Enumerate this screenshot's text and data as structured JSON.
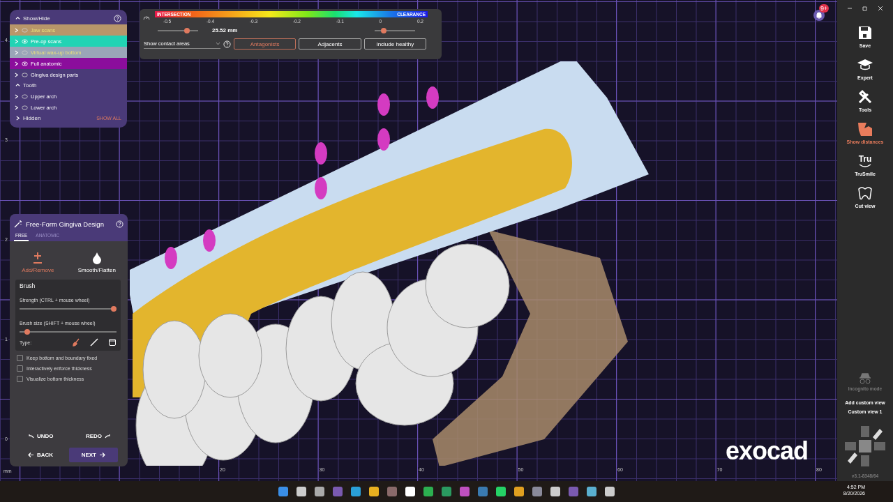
{
  "visibility_panel": {
    "sections": [
      {
        "title": "Show/Hide",
        "expanded": true,
        "items": [
          {
            "label": "Jaw scans",
            "color": "#b8966a",
            "visible": false
          },
          {
            "label": "Pre-op scans",
            "color": "#22d3b4",
            "visible": true
          },
          {
            "label": "Virtual wax-up bottom",
            "color": "#9aa5b8",
            "visible": false
          },
          {
            "label": "Full anatomic",
            "color": "#8b0d9c",
            "visible": true
          },
          {
            "label": "Gingiva design parts",
            "visible": false
          }
        ]
      },
      {
        "title": "Tooth",
        "expanded": true,
        "items": [
          {
            "label": "Upper arch",
            "visible": false
          },
          {
            "label": "Lower arch",
            "visible": false
          }
        ]
      },
      {
        "title": "Hidden",
        "expanded": false,
        "action": "SHOW ALL"
      }
    ]
  },
  "distance_panel": {
    "left_label": "INTERSECTION",
    "right_label": "CLEARANCE",
    "ticks": [
      "-0.5",
      "-0.4",
      "-0.3",
      "-0.2",
      "-0.1",
      "0",
      "0.2"
    ],
    "distance": "25.52 mm",
    "left_slider": {
      "level": 0.72
    },
    "right_slider": {
      "level": 0.22
    },
    "dropdown": "Show contact areas",
    "buttons": [
      {
        "label": "Antagonists",
        "selected": true
      },
      {
        "label": "Adjacents",
        "selected": false
      },
      {
        "label": "Include healthy",
        "selected": false
      }
    ]
  },
  "design_panel": {
    "title": "Free-Form Gingiva Design",
    "tabs": [
      {
        "label": "FREE",
        "selected": true
      },
      {
        "label": "ANATOMIC",
        "selected": false
      }
    ],
    "tools": [
      {
        "kind": "plusminus",
        "label": "Add/Remove",
        "selected": true
      },
      {
        "kind": "drop",
        "label": "Smooth/Flatten",
        "selected": false
      }
    ],
    "brush": {
      "title": "Brush",
      "sliders": [
        {
          "label": "Strength (CTRL + mouse wheel)",
          "level": 0.97
        },
        {
          "label": "Brush size (SHIFT + mouse wheel)",
          "level": 0.08
        }
      ],
      "type_label": "Type:",
      "types": [
        {
          "kind": "brush",
          "selected": true
        },
        {
          "kind": "pen",
          "selected": false
        },
        {
          "kind": "eraser",
          "selected": false
        }
      ]
    },
    "checkboxes": [
      {
        "label": "Keep bottom and boundary fixed",
        "checked": false
      },
      {
        "label": "Interactively enforce thickness",
        "checked": false
      },
      {
        "label": "Visualize bottom thickness",
        "checked": false
      }
    ],
    "undo": "UNDO",
    "redo": "REDO",
    "back": "BACK",
    "next": "NEXT"
  },
  "axes": {
    "y_ticks": [
      "4",
      "3",
      "2",
      "1",
      "0"
    ],
    "x_ticks": [
      "20",
      "30",
      "40",
      "50",
      "60",
      "70",
      "80"
    ],
    "unit": "mm"
  },
  "notification_badge": "9+",
  "logo": "exocad",
  "sidebar": {
    "tools": [
      {
        "kind": "save",
        "label": "Save",
        "selected": false
      },
      {
        "kind": "cap",
        "label": "Expert",
        "selected": false
      },
      {
        "kind": "tools",
        "label": "Tools",
        "selected": false
      },
      {
        "kind": "distances",
        "label": "Show distances",
        "selected": true
      },
      {
        "kind": "tru",
        "icon_text": "Tru",
        "label": "TruSmile",
        "selected": false
      },
      {
        "kind": "cut",
        "label": "Cut view",
        "selected": false
      }
    ],
    "incognito": {
      "label": "Incognito mode",
      "disabled": true
    },
    "add_view": "Add custom view",
    "custom_view": "Custom view 1",
    "version": "v3.1-8348/64"
  },
  "taskbar": {
    "time": "4:52 PM",
    "date": "8/20/2026"
  }
}
